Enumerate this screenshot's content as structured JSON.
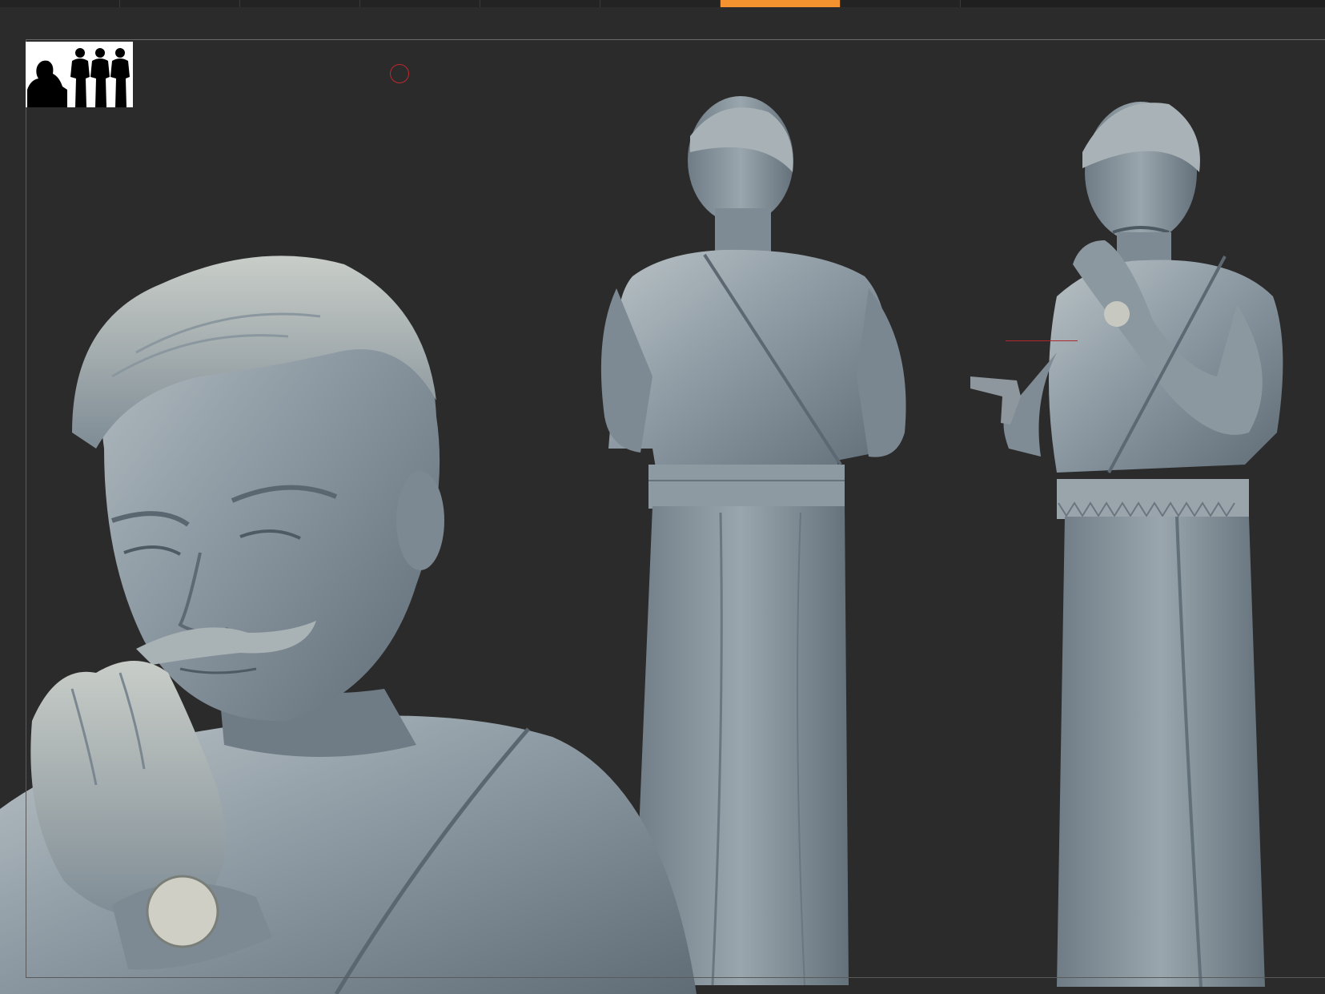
{
  "tabs": [
    {
      "state": "inactive"
    },
    {
      "state": "inactive"
    },
    {
      "state": "inactive"
    },
    {
      "state": "inactive"
    },
    {
      "state": "inactive"
    },
    {
      "state": "active"
    },
    {
      "state": "inactive"
    }
  ],
  "colors": {
    "background": "#2b2b2b",
    "accent": "#f39330",
    "sculpt_material": "#7d8a94",
    "cursor": "#c0282d"
  },
  "viewport": {
    "figures": [
      "bust-closeup",
      "full-figure-back",
      "full-figure-front"
    ],
    "icons": [
      "silhouette-thumbnail",
      "brush-cursor-icon"
    ]
  }
}
